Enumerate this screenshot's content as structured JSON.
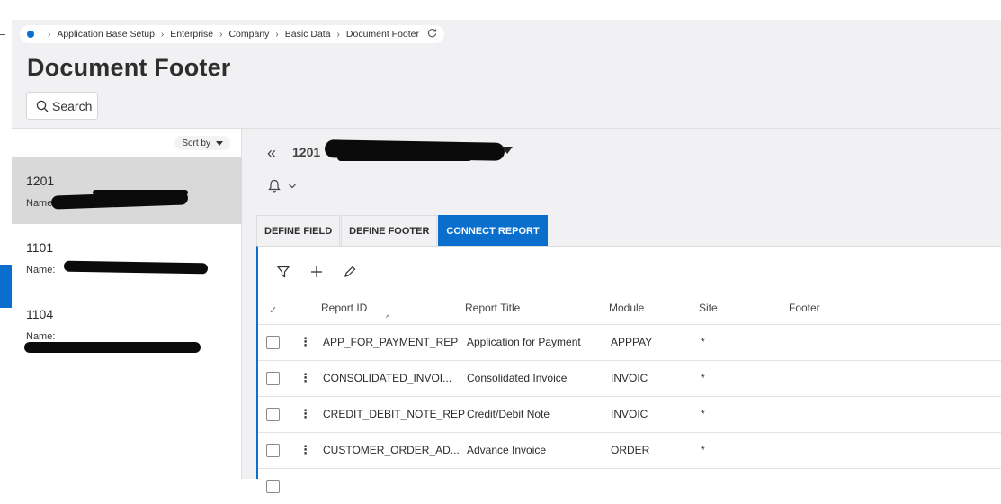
{
  "breadcrumb": [
    "Application Base Setup",
    "Enterprise",
    "Company",
    "Basic Data",
    "Document Footer"
  ],
  "page": {
    "title": "Document Footer",
    "search_label": "Search"
  },
  "list": {
    "sort_label": "Sort by",
    "items": [
      {
        "id": "1201",
        "name_label": "Name:"
      },
      {
        "id": "1101",
        "name_label": "Name:"
      },
      {
        "id": "1104",
        "name_label": "Name:"
      }
    ]
  },
  "detail": {
    "record_id": "1201",
    "tabs": [
      "DEFINE FIELD",
      "DEFINE FOOTER",
      "CONNECT REPORT"
    ],
    "active_tab": "CONNECT REPORT"
  },
  "grid": {
    "columns": [
      "Report ID",
      "Report Title",
      "Module",
      "Site",
      "Footer"
    ],
    "rows": [
      {
        "report_id": "APP_FOR_PAYMENT_REP",
        "title": "Application for Payment",
        "module": "APPPAY",
        "site": "*",
        "footer": ""
      },
      {
        "report_id": "CONSOLIDATED_INVOI...",
        "title": "Consolidated Invoice",
        "module": "INVOIC",
        "site": "*",
        "footer": ""
      },
      {
        "report_id": "CREDIT_DEBIT_NOTE_REP",
        "title": "Credit/Debit Note",
        "module": "INVOIC",
        "site": "*",
        "footer": ""
      },
      {
        "report_id": "CUSTOMER_ORDER_AD...",
        "title": "Advance Invoice",
        "module": "ORDER",
        "site": "*",
        "footer": ""
      }
    ]
  },
  "colors": {
    "accent": "#0a6ecd",
    "selected_row": "#d9d9d9",
    "background": "#f1f1f3"
  },
  "icons": [
    "home-dot-icon",
    "refresh-icon",
    "search-icon",
    "sort-caret-icon",
    "double-chevron-left-icon",
    "caret-down-icon",
    "bell-icon",
    "chevron-down-icon",
    "filter-icon",
    "plus-icon",
    "pencil-icon",
    "checkmark-icon",
    "sort-up-icon",
    "kebab-icon"
  ]
}
